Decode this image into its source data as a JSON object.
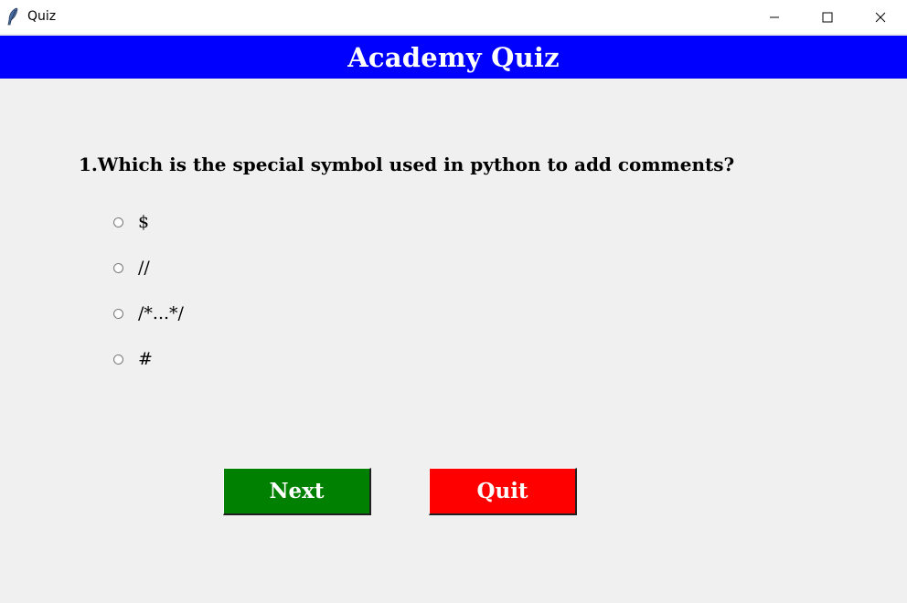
{
  "window": {
    "title": "Quiz"
  },
  "header": {
    "title": "Academy Quiz",
    "background": "#0000ff"
  },
  "question": {
    "text": "1.Which is the special symbol used in python to add comments?"
  },
  "options": [
    {
      "label": "$",
      "selected": false
    },
    {
      "label": "//",
      "selected": false
    },
    {
      "label": "/*...*/",
      "selected": false
    },
    {
      "label": "#",
      "selected": false
    }
  ],
  "buttons": {
    "next": {
      "label": "Next",
      "color": "#008000"
    },
    "quit": {
      "label": "Quit",
      "color": "#ff0000"
    }
  },
  "icons": {
    "app": "feather-icon",
    "minimize": "minimize-icon",
    "maximize": "maximize-icon",
    "close": "close-icon"
  }
}
